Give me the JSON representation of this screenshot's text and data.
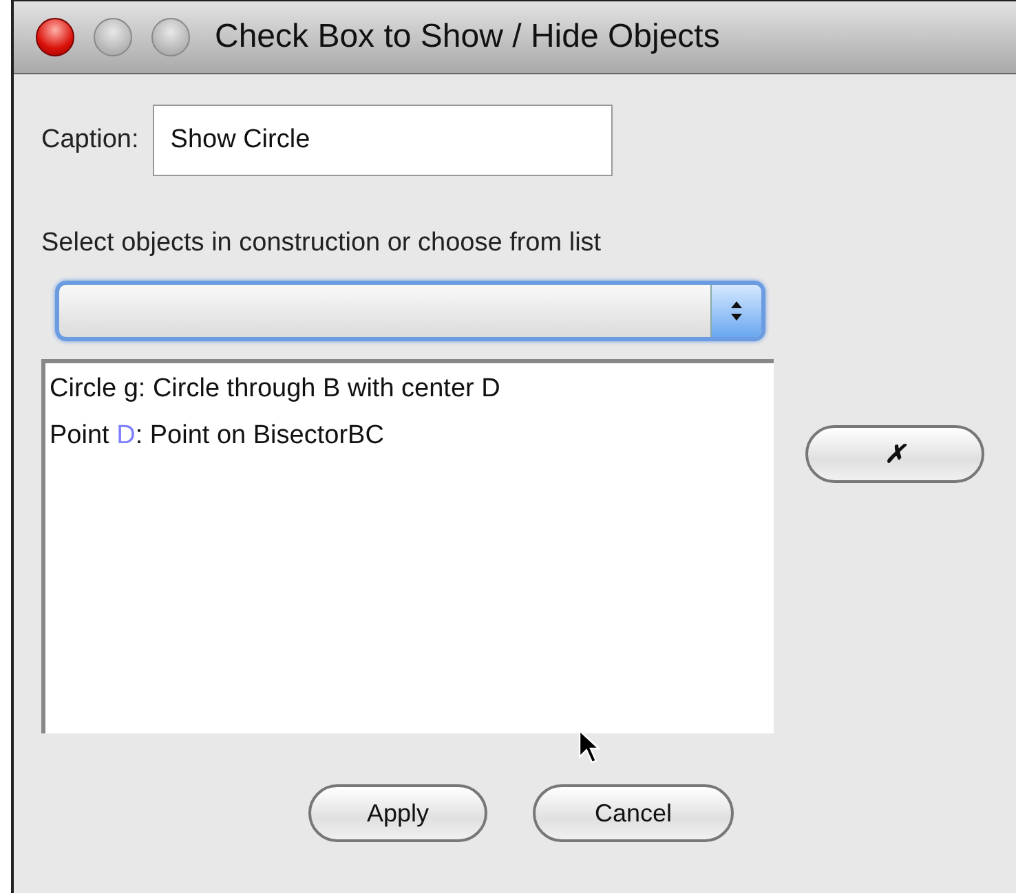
{
  "window": {
    "title": "Check Box to Show / Hide Objects",
    "controls": [
      {
        "active": true
      },
      {
        "active": false
      },
      {
        "active": false
      }
    ]
  },
  "caption": {
    "label": "Caption:",
    "value": "Show Circle"
  },
  "select_label": "Select objects in construction or choose from list",
  "dropdown": {
    "focused": true
  },
  "objects": [
    {
      "parts": [
        {
          "text": "Circle g: Circle through B with center D"
        }
      ]
    },
    {
      "parts": [
        {
          "text": "Point "
        },
        {
          "text": "D",
          "color": "#8080ff"
        },
        {
          "text": ": Point on BisectorBC"
        }
      ]
    }
  ],
  "remove_button": "✗",
  "buttons": [
    "Apply",
    "Cancel"
  ]
}
